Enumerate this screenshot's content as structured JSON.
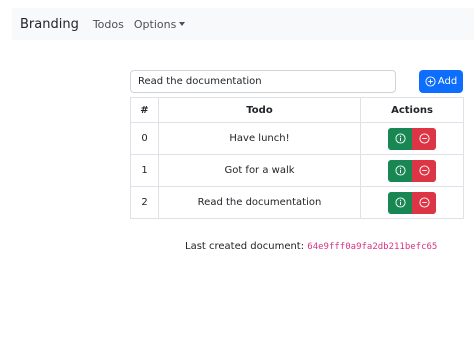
{
  "navbar": {
    "brand": "Branding",
    "links": [
      {
        "label": "Todos"
      },
      {
        "label": "Options"
      }
    ]
  },
  "form": {
    "input_value": "Read the documentation",
    "add_label": "Add"
  },
  "table": {
    "headers": [
      "#",
      "Todo",
      "Actions"
    ],
    "rows": [
      {
        "index": "0",
        "todo": "Have lunch!"
      },
      {
        "index": "1",
        "todo": "Got for a walk"
      },
      {
        "index": "2",
        "todo": "Read the documentation"
      }
    ]
  },
  "footer": {
    "label": "Last created document:",
    "document_id": "64e9fff0a9fa2db211befc65"
  },
  "colors": {
    "primary": "#0d6efd",
    "success": "#198754",
    "danger": "#dc3545",
    "code": "#d63384"
  },
  "icons": {
    "add": "plus-circle-icon",
    "info": "info-circle-icon",
    "delete": "dash-circle-icon",
    "options": "caret-down-icon"
  }
}
